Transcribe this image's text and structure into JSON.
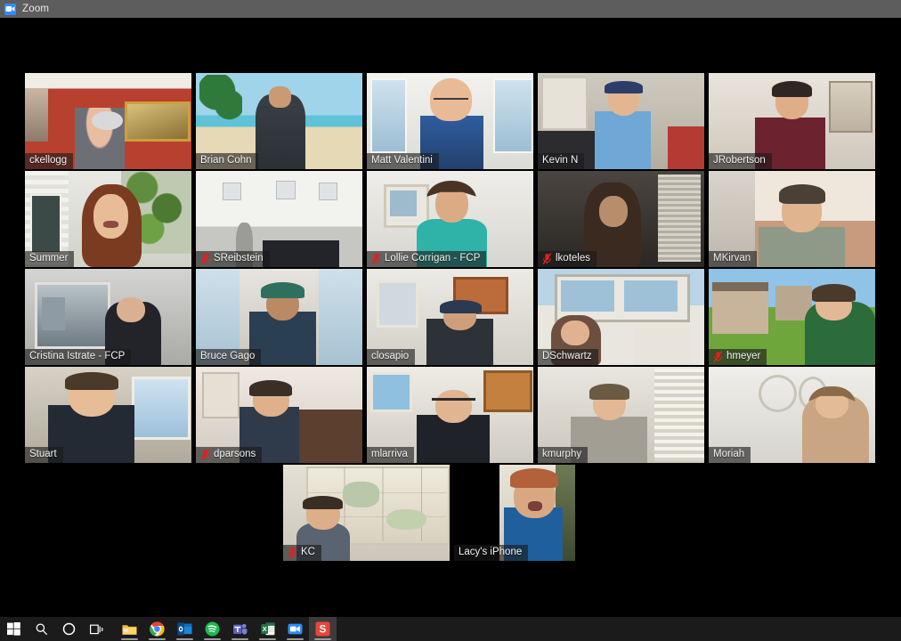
{
  "window": {
    "title": "Zoom",
    "icon": "zoom-camera-icon"
  },
  "meeting": {
    "view": "gallery",
    "participant_count": 22,
    "active_speaker": "Summer",
    "active_speaker_border_color": "#8fd14f",
    "mute_icon_color": "#e02020",
    "background_color": "#000000",
    "participants": [
      {
        "name": "ckellogg",
        "muted": false,
        "active": false,
        "row": 1,
        "col": 1
      },
      {
        "name": "Brian Cohn",
        "muted": false,
        "active": false,
        "row": 1,
        "col": 2
      },
      {
        "name": "Matt Valentini",
        "muted": false,
        "active": false,
        "row": 1,
        "col": 3
      },
      {
        "name": "Kevin N",
        "muted": false,
        "active": false,
        "row": 1,
        "col": 4
      },
      {
        "name": "JRobertson",
        "muted": false,
        "active": false,
        "row": 1,
        "col": 5
      },
      {
        "name": "Summer",
        "muted": false,
        "active": true,
        "row": 2,
        "col": 1
      },
      {
        "name": "SReibstein",
        "muted": true,
        "active": false,
        "row": 2,
        "col": 2
      },
      {
        "name": "Lollie Corrigan - FCP",
        "muted": true,
        "active": false,
        "row": 2,
        "col": 3
      },
      {
        "name": "lkoteles",
        "muted": true,
        "active": false,
        "row": 2,
        "col": 4
      },
      {
        "name": "MKirvan",
        "muted": false,
        "active": false,
        "row": 2,
        "col": 5
      },
      {
        "name": "Cristina Istrate - FCP",
        "muted": false,
        "active": false,
        "row": 3,
        "col": 1
      },
      {
        "name": "Bruce Gago",
        "muted": false,
        "active": false,
        "row": 3,
        "col": 2
      },
      {
        "name": "closapio",
        "muted": false,
        "active": false,
        "row": 3,
        "col": 3
      },
      {
        "name": "DSchwartz",
        "muted": false,
        "active": false,
        "row": 3,
        "col": 4
      },
      {
        "name": "hmeyer",
        "muted": true,
        "active": false,
        "row": 3,
        "col": 5
      },
      {
        "name": "Stuart",
        "muted": false,
        "active": false,
        "row": 4,
        "col": 1
      },
      {
        "name": "dparsons",
        "muted": true,
        "active": false,
        "row": 4,
        "col": 2
      },
      {
        "name": "mlarriva",
        "muted": false,
        "active": false,
        "row": 4,
        "col": 3
      },
      {
        "name": "kmurphy",
        "muted": false,
        "active": false,
        "row": 4,
        "col": 4
      },
      {
        "name": "Moriah",
        "muted": false,
        "active": false,
        "row": 4,
        "col": 5
      },
      {
        "name": "KC",
        "muted": true,
        "active": false,
        "row": 5,
        "col": 1
      },
      {
        "name": "Lacy's iPhone",
        "muted": false,
        "active": false,
        "row": 5,
        "col": 2
      }
    ]
  },
  "taskbar": {
    "background_color": "#1b1b1b",
    "system_buttons": [
      {
        "name": "start-button",
        "icon": "windows-logo-icon"
      },
      {
        "name": "search-button",
        "icon": "search-icon"
      },
      {
        "name": "cortana-button",
        "icon": "cortana-circle-icon"
      },
      {
        "name": "task-view-button",
        "icon": "task-view-icon"
      }
    ],
    "apps": [
      {
        "label": "File Explorer",
        "icon": "folder-icon",
        "color": "#f8c34e",
        "running": true,
        "active": false
      },
      {
        "label": "Google Chrome",
        "icon": "chrome-icon",
        "color": "#ffffff",
        "running": true,
        "active": false
      },
      {
        "label": "Outlook",
        "icon": "outlook-icon",
        "color": "#0f6cbd",
        "running": true,
        "active": false
      },
      {
        "label": "Spotify",
        "icon": "spotify-icon",
        "color": "#1db954",
        "running": true,
        "active": false
      },
      {
        "label": "Microsoft Teams",
        "icon": "teams-icon",
        "color": "#5b5fc7",
        "running": true,
        "active": false
      },
      {
        "label": "Excel",
        "icon": "excel-icon",
        "color": "#217346",
        "running": true,
        "active": false
      },
      {
        "label": "Zoom",
        "icon": "zoom-icon",
        "color": "#2d8cff",
        "running": true,
        "active": false
      },
      {
        "label": "Snagit",
        "icon": "snagit-icon",
        "color": "#e8453c",
        "running": true,
        "active": true
      }
    ]
  }
}
